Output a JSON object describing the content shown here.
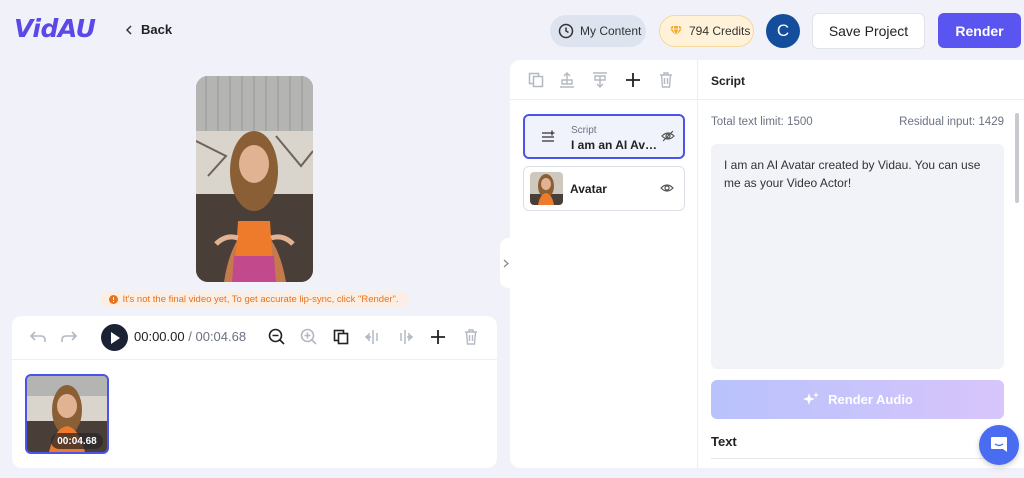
{
  "brand": {
    "logo": "VidAU"
  },
  "header": {
    "back_label": "Back",
    "my_content_label": "My Content",
    "credits_label": "794 Credits",
    "user_initial": "C",
    "save_label": "Save Project",
    "render_label": "Render"
  },
  "preview": {
    "warning": "It's not the final video yet, To get accurate lip-sync, click \"Render\"."
  },
  "timeline": {
    "current_time": "00:00.00",
    "separator": "/",
    "duration": "00:04.68",
    "clip_duration": "00:04.68"
  },
  "layers": {
    "items": [
      {
        "type_label": "Script",
        "title": "I am an AI Avatar created by Vidau.",
        "active": true
      },
      {
        "title": "Avatar",
        "active": false
      }
    ]
  },
  "script_panel": {
    "heading": "Script",
    "total_limit": "Total text limit: 1500",
    "residual": "Residual input: 1429",
    "text": "I am an AI Avatar created by Vidau. You can use me as your Video Actor!",
    "render_audio_label": "Render Audio",
    "text_section_label": "Text"
  },
  "colors": {
    "accent": "#5a55f0",
    "background": "#f0f1f9",
    "warning": "#e8731f",
    "selected_border": "#4a54e8"
  }
}
